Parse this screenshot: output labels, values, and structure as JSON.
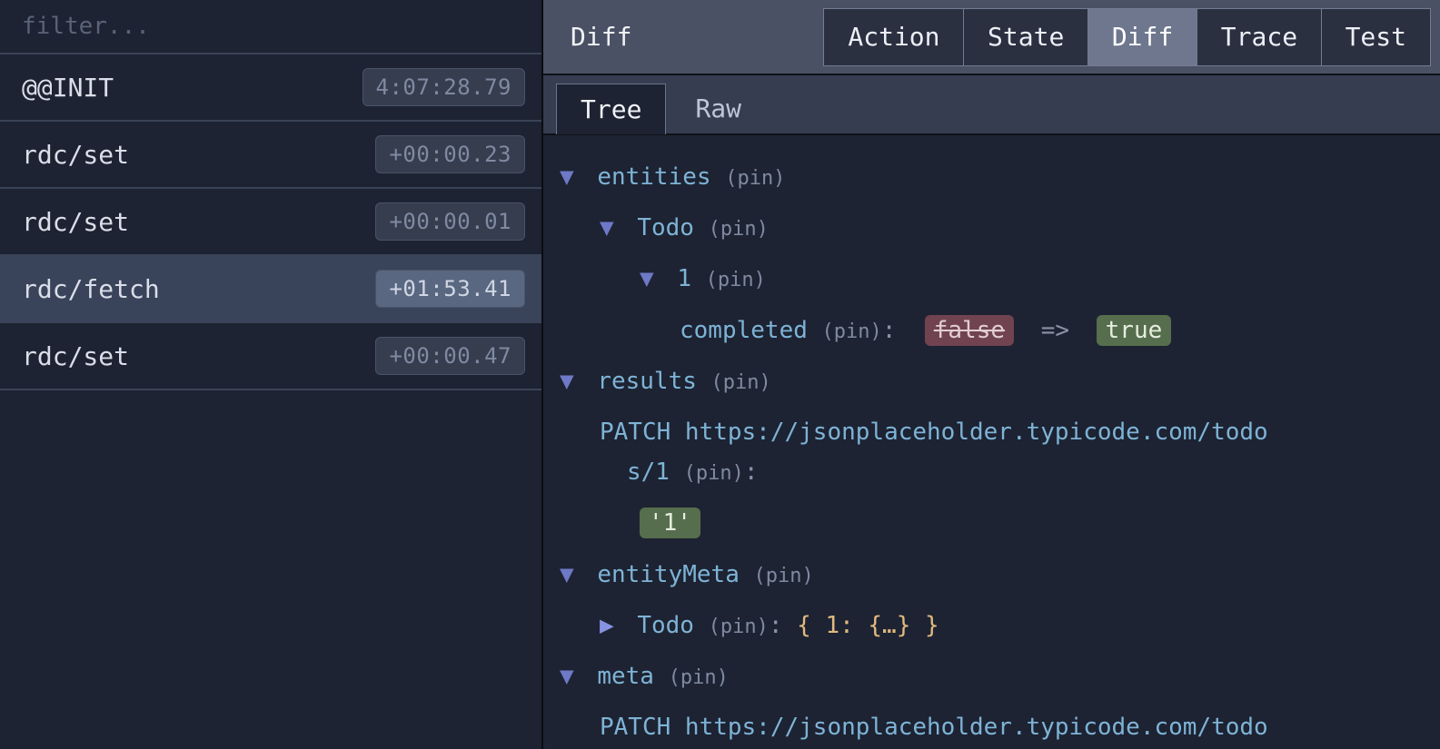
{
  "filter": {
    "placeholder": "filter..."
  },
  "actions": [
    {
      "name": "@@INIT",
      "time": "4:07:28.79",
      "selected": false
    },
    {
      "name": "rdc/set",
      "time": "+00:00.23",
      "selected": false
    },
    {
      "name": "rdc/set",
      "time": "+00:00.01",
      "selected": false
    },
    {
      "name": "rdc/fetch",
      "time": "+01:53.41",
      "selected": true
    },
    {
      "name": "rdc/set",
      "time": "+00:00.47",
      "selected": false
    }
  ],
  "header": {
    "title": "Diff"
  },
  "topTabs": {
    "action": "Action",
    "state": "State",
    "diff": "Diff",
    "trace": "Trace",
    "test": "Test",
    "active": "diff"
  },
  "subTabs": {
    "tree": "Tree",
    "raw": "Raw",
    "active": "tree"
  },
  "pinLabel": "(pin)",
  "tree": {
    "entities": "entities",
    "todo": "Todo",
    "item1": "1",
    "completed": "completed",
    "oldVal": "false",
    "newVal": "true",
    "results": "results",
    "patchUrl1": "PATCH https://jsonplaceholder.typicode.com/todo",
    "patchUrl2": "s/1",
    "patchResult": "'1'",
    "entityMeta": "entityMeta",
    "entityMetaTodo": "Todo",
    "entityMetaCollapsed": "{ 1: {…} }",
    "meta": "meta",
    "metaUrl": "PATCH https://jsonplaceholder.typicode.com/todo"
  },
  "arrowSep": "=>"
}
